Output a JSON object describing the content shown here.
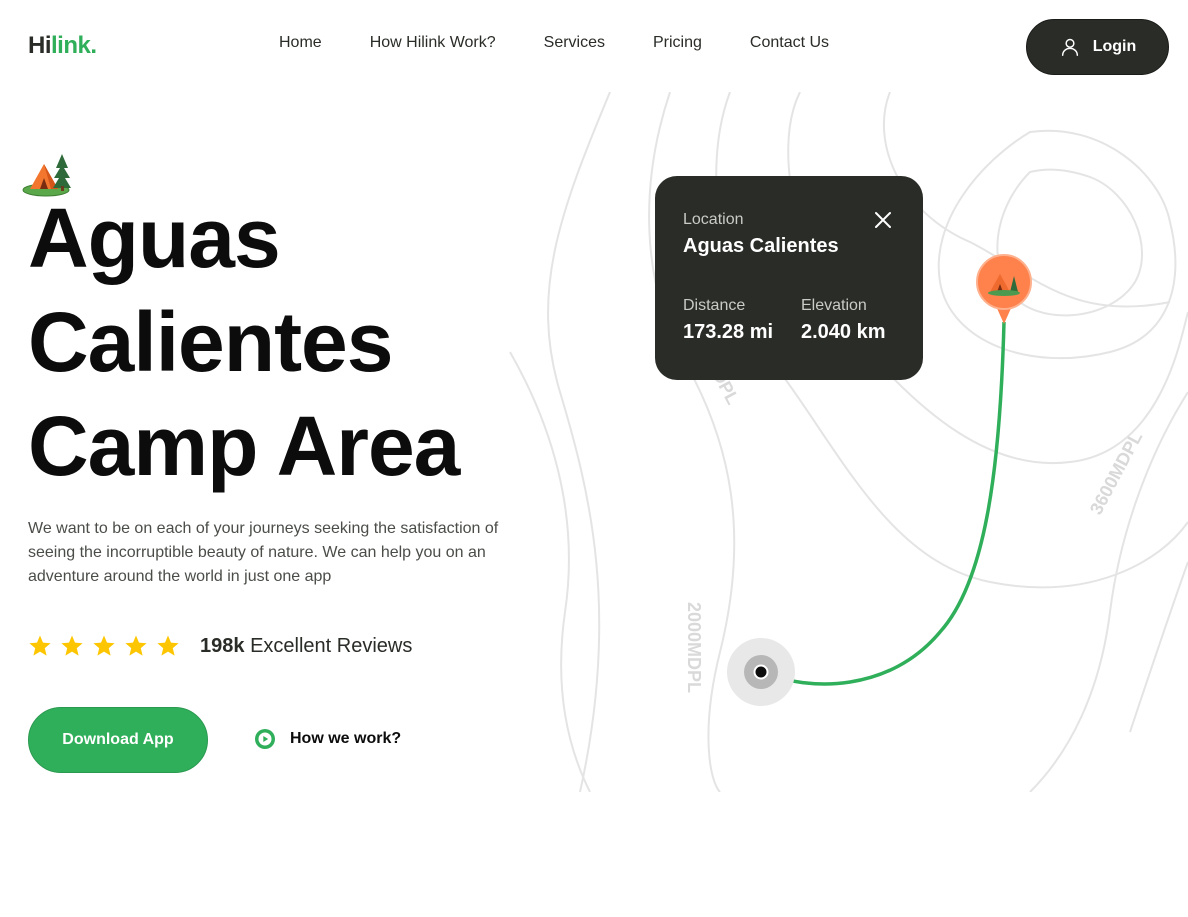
{
  "brand": {
    "logo_prefix": "Hi",
    "logo_suffix": "link."
  },
  "nav": {
    "items": [
      {
        "label": "Home"
      },
      {
        "label": "How Hilink Work?"
      },
      {
        "label": "Services"
      },
      {
        "label": "Pricing"
      },
      {
        "label": "Contact Us"
      }
    ]
  },
  "header": {
    "login_label": "Login"
  },
  "hero": {
    "title_lines": [
      "Aguas",
      "Calientes",
      "Camp Area"
    ],
    "description": "We want to be on each of your journeys seeking the satisfaction of seeing the incorruptible beauty of nature. We can help you on an adventure around the world in just one app",
    "rating": {
      "stars": 5,
      "count": "198k",
      "label": "Excellent Reviews"
    },
    "download_label": "Download App",
    "how_label": "How we work?"
  },
  "card": {
    "location_label": "Location",
    "location_value": "Aguas Calientes",
    "distance_label": "Distance",
    "distance_value": "173.28 mi",
    "elevation_label": "Elevation",
    "elevation_value": "2.040 km"
  },
  "map": {
    "contour_labels": [
      "DPL",
      "3600MDPL",
      "2000MDPL"
    ]
  },
  "colors": {
    "accent": "#30af5b",
    "dark": "#292c27",
    "star": "#fec601",
    "pin": "#ff814c"
  }
}
